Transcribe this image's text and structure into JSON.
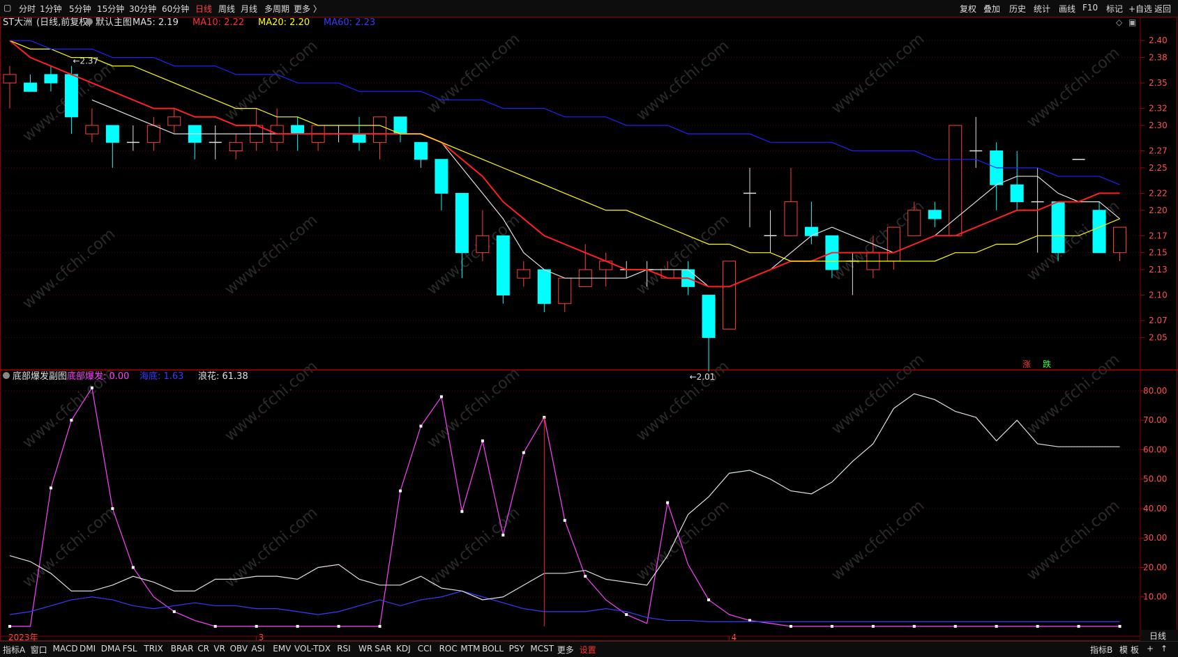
{
  "toolbar": {
    "periods": [
      "分时",
      "1分钟",
      "5分钟",
      "15分钟",
      "30分钟",
      "60分钟",
      "日线",
      "周线",
      "月线",
      "多周期",
      "更多 〉"
    ],
    "active_period": "日线",
    "right": [
      "复权",
      "叠加",
      "历史",
      "统计",
      "画线",
      "F10",
      "标记",
      "+自选",
      "返回"
    ]
  },
  "main_legend": {
    "name": "ST大洲",
    "mode": "(日线,前复权)",
    "template": "默认主图",
    "ma": [
      {
        "label": "MA5: 2.19",
        "color": "#e0e0e0"
      },
      {
        "label": "MA10: 2.22",
        "color": "#ff3030"
      },
      {
        "label": "MA20: 2.20",
        "color": "#ffff00"
      },
      {
        "label": "MA60: 2.23",
        "color": "#3a3aff"
      }
    ]
  },
  "sub_legend": {
    "name": "底部爆发副图",
    "items": [
      {
        "label": "底部爆发: 0.00",
        "color": "#ff40ff"
      },
      {
        "label": "海底: 1.63",
        "color": "#3a3aff"
      },
      {
        "label": "浪花: 61.38",
        "color": "#e0e0e0"
      }
    ]
  },
  "rise_fall": {
    "rise": "涨",
    "fall": "跌"
  },
  "watermark": "www.cfchi.com",
  "bottom": {
    "left": [
      "指标A",
      "窗口",
      "MACD",
      "DMI",
      "DMA",
      "FSL",
      "TRIX",
      "BRAR",
      "CR",
      "VR",
      "OBV",
      "ASI",
      "EMV",
      "VOL-TDX",
      "RSI",
      "WR",
      "SAR",
      "KDJ",
      "CCI",
      "ROC",
      "MTM",
      "BOLL",
      "PSY",
      "MCST",
      "更多",
      "设置"
    ],
    "right": [
      "指标B",
      "模",
      "板"
    ],
    "period": "日线"
  },
  "chart_data": [
    {
      "type": "candlestick",
      "title": "ST大洲",
      "ylim": [
        2.02,
        2.41
      ],
      "yticks": [
        "2.40",
        "2.38",
        "2.35",
        "2.32",
        "2.30",
        "2.27",
        "2.25",
        "2.22",
        "2.20",
        "2.17",
        "2.15",
        "2.13",
        "2.10",
        "2.07",
        "2.05"
      ],
      "x_labels": [
        {
          "index": 0,
          "label": "2023年"
        },
        {
          "index": 12,
          "label": "3"
        },
        {
          "index": 35,
          "label": "4"
        }
      ],
      "annotations": [
        {
          "index": 3,
          "label": "2.37",
          "price": 2.37
        },
        {
          "index": 33,
          "label": "2.01",
          "price": 2.01
        }
      ],
      "candles": [
        [
          2.35,
          2.36,
          2.37,
          2.32
        ],
        [
          2.35,
          2.34,
          2.36,
          2.34
        ],
        [
          2.36,
          2.35,
          2.37,
          2.34
        ],
        [
          2.36,
          2.31,
          2.37,
          2.29
        ],
        [
          2.29,
          2.3,
          2.32,
          2.28
        ],
        [
          2.3,
          2.28,
          2.3,
          2.25
        ],
        [
          2.28,
          2.28,
          2.3,
          2.27
        ],
        [
          2.28,
          2.3,
          2.31,
          2.27
        ],
        [
          2.3,
          2.31,
          2.32,
          2.29
        ],
        [
          2.3,
          2.28,
          2.3,
          2.26
        ],
        [
          2.28,
          2.28,
          2.3,
          2.26
        ],
        [
          2.27,
          2.28,
          2.29,
          2.26
        ],
        [
          2.28,
          2.3,
          2.32,
          2.27
        ],
        [
          2.28,
          2.3,
          2.32,
          2.27
        ],
        [
          2.3,
          2.29,
          2.31,
          2.27
        ],
        [
          2.28,
          2.3,
          2.3,
          2.27
        ],
        [
          2.29,
          2.29,
          2.3,
          2.28
        ],
        [
          2.29,
          2.28,
          2.31,
          2.27
        ],
        [
          2.28,
          2.31,
          2.31,
          2.26
        ],
        [
          2.31,
          2.29,
          2.31,
          2.28
        ],
        [
          2.28,
          2.26,
          2.28,
          2.25
        ],
        [
          2.26,
          2.22,
          2.26,
          2.2
        ],
        [
          2.22,
          2.15,
          2.22,
          2.12
        ],
        [
          2.15,
          2.17,
          2.2,
          2.14
        ],
        [
          2.17,
          2.1,
          2.17,
          2.09
        ],
        [
          2.12,
          2.13,
          2.14,
          2.11
        ],
        [
          2.13,
          2.09,
          2.13,
          2.08
        ],
        [
          2.09,
          2.12,
          2.12,
          2.08
        ],
        [
          2.11,
          2.13,
          2.16,
          2.11
        ],
        [
          2.13,
          2.14,
          2.15,
          2.11
        ],
        [
          2.13,
          2.13,
          2.14,
          2.12
        ],
        [
          2.13,
          2.13,
          2.14,
          2.11
        ],
        [
          2.12,
          2.13,
          2.14,
          2.12
        ],
        [
          2.13,
          2.11,
          2.14,
          2.1
        ],
        [
          2.1,
          2.05,
          2.1,
          2.01
        ],
        [
          2.06,
          2.14,
          2.14,
          2.06
        ],
        [
          2.22,
          2.22,
          2.25,
          2.18
        ],
        [
          2.17,
          2.17,
          2.2,
          2.15
        ],
        [
          2.17,
          2.21,
          2.25,
          2.17
        ],
        [
          2.18,
          2.17,
          2.21,
          2.16
        ],
        [
          2.17,
          2.13,
          2.17,
          2.12
        ],
        [
          2.14,
          2.14,
          2.15,
          2.1
        ],
        [
          2.13,
          2.15,
          2.17,
          2.12
        ],
        [
          2.14,
          2.18,
          2.18,
          2.13
        ],
        [
          2.17,
          2.2,
          2.21,
          2.17
        ],
        [
          2.2,
          2.19,
          2.21,
          2.18
        ],
        [
          2.17,
          2.3,
          2.3,
          2.17
        ],
        [
          2.27,
          2.27,
          2.31,
          2.25
        ],
        [
          2.27,
          2.23,
          2.28,
          2.2
        ],
        [
          2.23,
          2.21,
          2.27,
          2.2
        ],
        [
          2.21,
          2.21,
          2.25,
          2.15
        ],
        [
          2.21,
          2.15,
          2.21,
          2.14
        ],
        [
          2.26,
          2.26,
          2.26,
          2.26
        ],
        [
          2.2,
          2.15,
          2.21,
          2.15
        ],
        [
          2.15,
          2.18,
          2.18,
          2.14
        ]
      ],
      "series": [
        {
          "name": "MA5",
          "color": "#e0e0e0",
          "values": [
            null,
            null,
            null,
            null,
            2.33,
            2.32,
            2.31,
            2.3,
            2.29,
            2.29,
            2.29,
            2.29,
            2.29,
            2.29,
            2.29,
            2.29,
            2.29,
            2.29,
            2.29,
            2.29,
            2.29,
            2.28,
            2.25,
            2.22,
            2.19,
            2.15,
            2.13,
            2.12,
            2.12,
            2.12,
            2.12,
            2.13,
            2.13,
            2.13,
            2.11,
            2.11,
            2.12,
            2.13,
            2.15,
            2.17,
            2.18,
            2.17,
            2.16,
            2.15,
            2.16,
            2.17,
            2.19,
            2.21,
            2.23,
            2.24,
            2.24,
            2.22,
            2.21,
            2.21,
            2.19
          ]
        },
        {
          "name": "MA10",
          "color": "#ff2020",
          "values": [
            2.4,
            2.38,
            2.37,
            2.36,
            2.35,
            2.34,
            2.33,
            2.32,
            2.32,
            2.31,
            2.31,
            2.3,
            2.3,
            2.29,
            2.29,
            2.29,
            2.29,
            2.29,
            2.29,
            2.29,
            2.29,
            2.28,
            2.26,
            2.24,
            2.21,
            2.19,
            2.17,
            2.16,
            2.15,
            2.14,
            2.13,
            2.13,
            2.12,
            2.12,
            2.11,
            2.11,
            2.12,
            2.13,
            2.14,
            2.14,
            2.15,
            2.15,
            2.15,
            2.15,
            2.16,
            2.17,
            2.17,
            2.18,
            2.19,
            2.2,
            2.2,
            2.21,
            2.21,
            2.22,
            2.22
          ]
        },
        {
          "name": "MA20",
          "color": "#ffff00",
          "values": [
            2.4,
            2.39,
            2.39,
            2.38,
            2.38,
            2.37,
            2.37,
            2.36,
            2.35,
            2.34,
            2.33,
            2.32,
            2.32,
            2.31,
            2.31,
            2.3,
            2.3,
            2.3,
            2.3,
            2.29,
            2.29,
            2.28,
            2.27,
            2.26,
            2.25,
            2.24,
            2.23,
            2.22,
            2.21,
            2.2,
            2.2,
            2.19,
            2.18,
            2.17,
            2.16,
            2.16,
            2.15,
            2.15,
            2.14,
            2.14,
            2.14,
            2.14,
            2.14,
            2.14,
            2.14,
            2.14,
            2.15,
            2.15,
            2.16,
            2.16,
            2.17,
            2.17,
            2.17,
            2.18,
            2.19
          ]
        },
        {
          "name": "MA60",
          "color": "#2020ff",
          "values": [
            2.4,
            2.4,
            2.39,
            2.39,
            2.39,
            2.38,
            2.38,
            2.38,
            2.37,
            2.37,
            2.37,
            2.36,
            2.36,
            2.36,
            2.35,
            2.35,
            2.35,
            2.34,
            2.34,
            2.34,
            2.34,
            2.33,
            2.33,
            2.33,
            2.32,
            2.32,
            2.32,
            2.31,
            2.31,
            2.31,
            2.3,
            2.3,
            2.3,
            2.29,
            2.29,
            2.29,
            2.29,
            2.28,
            2.28,
            2.28,
            2.28,
            2.27,
            2.27,
            2.27,
            2.27,
            2.26,
            2.26,
            2.26,
            2.25,
            2.25,
            2.25,
            2.24,
            2.24,
            2.24,
            2.23
          ]
        }
      ]
    },
    {
      "type": "line",
      "title": "底部爆发副图",
      "ylim": [
        0,
        84
      ],
      "yticks": [
        "80.00",
        "70.00",
        "60.00",
        "50.00",
        "40.00",
        "30.00",
        "20.00",
        "10.00"
      ],
      "series": [
        {
          "name": "底部爆发",
          "color": "#ff40ff",
          "dots": true,
          "values": [
            0,
            0,
            47,
            70,
            81,
            40,
            20,
            10,
            5,
            2,
            0,
            0,
            0,
            0,
            0,
            0,
            0,
            0,
            0,
            46,
            68,
            78,
            39,
            63,
            31,
            59,
            71,
            36,
            17,
            9,
            4,
            1,
            42,
            21,
            9,
            4,
            2,
            1,
            0,
            0,
            0,
            0,
            0,
            0,
            0,
            0,
            0,
            0,
            0,
            0,
            0,
            0,
            0,
            0,
            0
          ]
        },
        {
          "name": "海底",
          "color": "#3a3aff",
          "values": [
            4,
            5,
            7,
            9,
            10,
            9,
            7,
            6,
            7,
            8,
            7,
            7,
            6,
            6,
            5,
            4,
            5,
            7,
            9,
            7,
            9,
            10,
            12,
            10,
            8,
            6,
            5,
            5,
            5,
            6,
            5,
            3,
            2,
            2,
            1.6,
            1.6,
            1.6,
            1.6,
            1.6,
            1.6,
            1.6,
            1.6,
            1.6,
            1.6,
            1.6,
            1.6,
            1.6,
            1.6,
            1.6,
            1.6,
            1.6,
            1.6,
            1.6,
            1.6,
            1.6
          ]
        },
        {
          "name": "浪花",
          "color": "#e0e0e0",
          "values": [
            24,
            22,
            18,
            12,
            12,
            14,
            17,
            15,
            12,
            12,
            16,
            16,
            17,
            17,
            16,
            20,
            21,
            16,
            14,
            14,
            17,
            13,
            12,
            9,
            10,
            14,
            18,
            18,
            19,
            16,
            15,
            14,
            24,
            38,
            44,
            52,
            53,
            50,
            46,
            45,
            49,
            56,
            62,
            74,
            79,
            77,
            73,
            71,
            63,
            70,
            62,
            61,
            61,
            61,
            61
          ]
        }
      ]
    }
  ]
}
